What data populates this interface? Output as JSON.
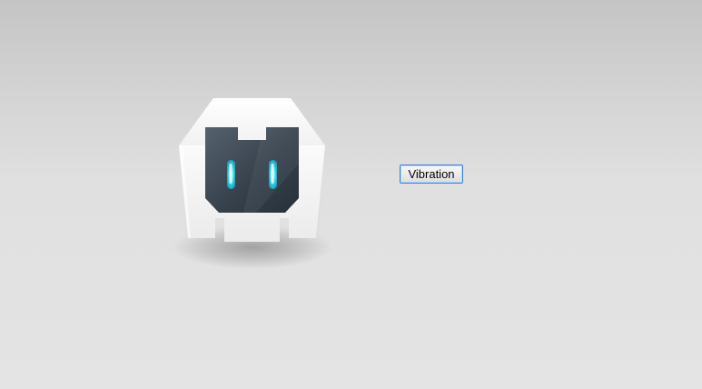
{
  "page": {
    "background_top": "#c4c4c4",
    "background_bottom": "#e4e4e4"
  },
  "logo": {
    "icon": "cordova-robot-logo-icon",
    "body_color": "#f3f3f3",
    "face_color": "#3e4a56",
    "eye_color": "#4fe3f7"
  },
  "controls": {
    "vibration_label": "Vibration",
    "button_border_color": "#3c7fd6"
  }
}
